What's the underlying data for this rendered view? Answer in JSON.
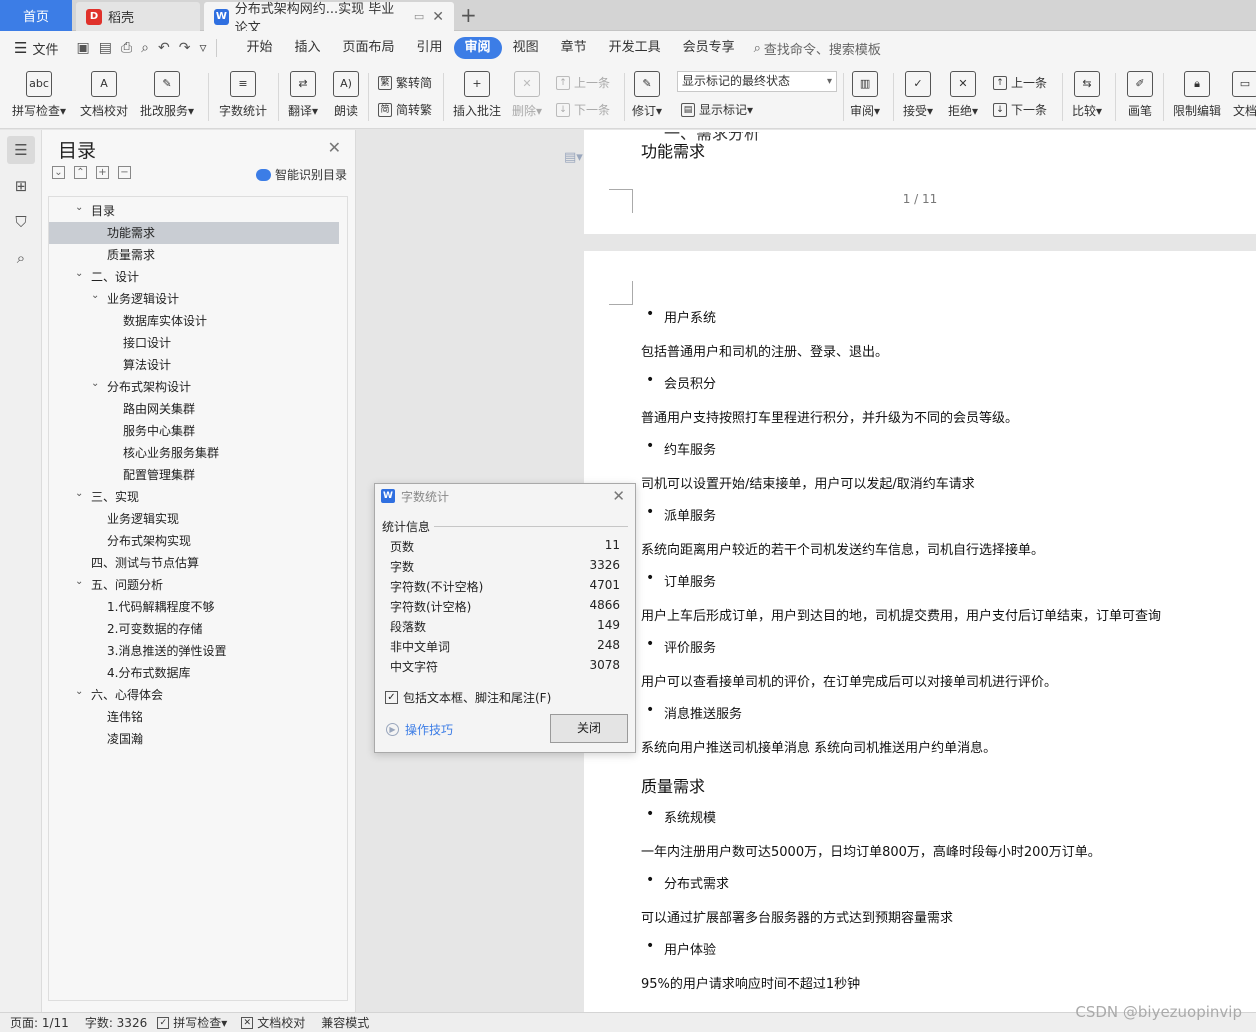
{
  "tabs": {
    "home": "首页",
    "daoke": "稻壳",
    "doc": "分布式架构网约...实现 毕业论文"
  },
  "menubar": {
    "file": "文件",
    "items": [
      "开始",
      "插入",
      "页面布局",
      "引用",
      "审阅",
      "视图",
      "章节",
      "开发工具",
      "会员专享"
    ],
    "active": "审阅",
    "search": "查找命令、搜索模板"
  },
  "ribbon": {
    "spell": "拼写检查",
    "proofread": "文档校对",
    "revise_service": "批改服务",
    "word_count": "字数统计",
    "translate": "翻译",
    "read_aloud": "朗读",
    "to_traditional": "繁转简",
    "to_simplified": "简转繁",
    "insert_comment": "插入批注",
    "delete": "删除",
    "prev_comment": "上一条",
    "next_comment": "下一条",
    "revision": "修订",
    "markup_state": "显示标记的最终状态",
    "show_markup": "显示标记",
    "review": "审阅",
    "accept": "接受",
    "reject": "拒绝",
    "prev_change": "上一条",
    "next_change": "下一条",
    "compare": "比较",
    "pen": "画笔",
    "restrict": "限制编辑",
    "doc_more": "文档"
  },
  "toc": {
    "title": "目录",
    "smart": "智能识别目录",
    "items": [
      {
        "label": "目录",
        "level": 0,
        "caret": true
      },
      {
        "label": "功能需求",
        "level": 1,
        "selected": true
      },
      {
        "label": "质量需求",
        "level": 1
      },
      {
        "label": "二、设计",
        "level": 0,
        "caret": true
      },
      {
        "label": "业务逻辑设计",
        "level": 1,
        "caret": true
      },
      {
        "label": "数据库实体设计",
        "level": 2
      },
      {
        "label": "接口设计",
        "level": 2
      },
      {
        "label": "算法设计",
        "level": 2
      },
      {
        "label": "分布式架构设计",
        "level": 1,
        "caret": true
      },
      {
        "label": "路由网关集群",
        "level": 2
      },
      {
        "label": "服务中心集群",
        "level": 2
      },
      {
        "label": "核心业务服务集群",
        "level": 2
      },
      {
        "label": "配置管理集群",
        "level": 2
      },
      {
        "label": "三、实现",
        "level": 0,
        "caret": true
      },
      {
        "label": "业务逻辑实现",
        "level": 1
      },
      {
        "label": "分布式架构实现",
        "level": 1
      },
      {
        "label": "四、测试与节点估算",
        "level": 0
      },
      {
        "label": "五、问题分析",
        "level": 0,
        "caret": true
      },
      {
        "label": "1.代码解耦程度不够",
        "level": 1
      },
      {
        "label": "2.可变数据的存储",
        "level": 1
      },
      {
        "label": "3.消息推送的弹性设置",
        "level": 1
      },
      {
        "label": "4.分布式数据库",
        "level": 1
      },
      {
        "label": "六、心得体会",
        "level": 0,
        "caret": true
      },
      {
        "label": "连伟铭",
        "level": 1
      },
      {
        "label": "凌国瀚",
        "level": 1
      }
    ]
  },
  "document": {
    "page1_partial": "一、需求分析",
    "page1_heading": "功能需求",
    "page1_num": "1 / 11",
    "blocks": [
      {
        "type": "bullet",
        "text": "用户系统"
      },
      {
        "type": "para",
        "text": "包括普通用户和司机的注册、登录、退出。"
      },
      {
        "type": "bullet",
        "text": "会员积分"
      },
      {
        "type": "para",
        "text": "普通用户支持按照打车里程进行积分，并升级为不同的会员等级。"
      },
      {
        "type": "bullet",
        "text": "约车服务"
      },
      {
        "type": "para",
        "text": "司机可以设置开始/结束接单，用户可以发起/取消约车请求"
      },
      {
        "type": "bullet",
        "text": "派单服务"
      },
      {
        "type": "para",
        "text": "系统向距离用户较近的若干个司机发送约车信息，司机自行选择接单。"
      },
      {
        "type": "bullet",
        "text": "订单服务"
      },
      {
        "type": "para",
        "text": "用户上车后形成订单，用户到达目的地，司机提交费用，用户支付后订单结束，订单可查询"
      },
      {
        "type": "bullet",
        "text": "评价服务"
      },
      {
        "type": "para",
        "text": "用户可以查看接单司机的评价，在订单完成后可以对接单司机进行评价。"
      },
      {
        "type": "bullet",
        "text": "消息推送服务"
      },
      {
        "type": "para",
        "text": "系统向用户推送司机接单消息 系统向司机推送用户约单消息。"
      },
      {
        "type": "heading",
        "text": "质量需求"
      },
      {
        "type": "bullet",
        "text": "系统规模"
      },
      {
        "type": "para",
        "text": "一年内注册用户数可达5000万，日均订单800万，高峰时段每小时200万订单。"
      },
      {
        "type": "bullet",
        "text": "分布式需求"
      },
      {
        "type": "para",
        "text": "可以通过扩展部署多台服务器的方式达到预期容量需求"
      },
      {
        "type": "bullet",
        "text": "用户体验"
      },
      {
        "type": "para",
        "text": "95%的用户请求响应时间不超过1秒钟"
      }
    ]
  },
  "dialog": {
    "title": "字数统计",
    "section": "统计信息",
    "stats": [
      {
        "label": "页数",
        "value": "11"
      },
      {
        "label": "字数",
        "value": "3326"
      },
      {
        "label": "字符数(不计空格)",
        "value": "4701"
      },
      {
        "label": "字符数(计空格)",
        "value": "4866"
      },
      {
        "label": "段落数",
        "value": "149"
      },
      {
        "label": "非中文单词",
        "value": "248"
      },
      {
        "label": "中文字符",
        "value": "3078"
      }
    ],
    "include": "包括文本框、脚注和尾注(F)",
    "tips": "操作技巧",
    "close": "关闭"
  },
  "status": {
    "page": "页面: 1/11",
    "words": "字数: 3326",
    "spell": "拼写检查",
    "proofread": "文档校对",
    "compat": "兼容模式"
  },
  "watermark": "CSDN @biyezuopinvip"
}
